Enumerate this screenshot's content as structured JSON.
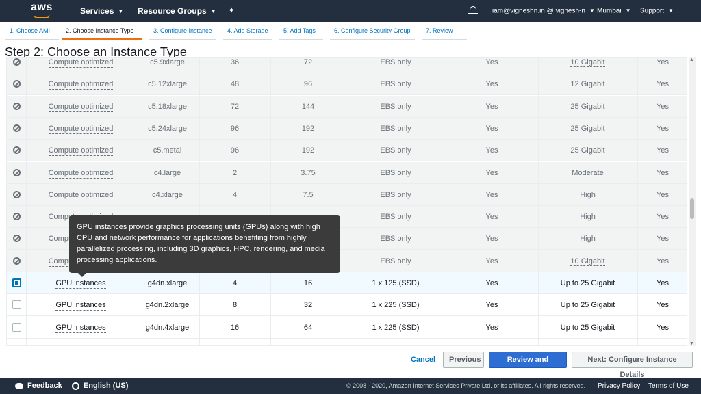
{
  "nav": {
    "logo": "aws",
    "services": "Services",
    "resource_groups": "Resource Groups",
    "user": "iam@vigneshn.in @ vignesh-n",
    "region": "Mumbai",
    "support": "Support"
  },
  "tabs": [
    {
      "label": "1. Choose AMI"
    },
    {
      "label": "2. Choose Instance Type"
    },
    {
      "label": "3. Configure Instance"
    },
    {
      "label": "4. Add Storage"
    },
    {
      "label": "5. Add Tags"
    },
    {
      "label": "6. Configure Security Group"
    },
    {
      "label": "7. Review"
    }
  ],
  "page_title": "Step 2: Choose an Instance Type",
  "rows": [
    {
      "state": "disabled",
      "family": "Compute optimized",
      "type": "c5.9xlarge",
      "vcpus": "36",
      "memory": "72",
      "storage": "EBS only",
      "ebs_opt": "Yes",
      "network": "10 Gigabit",
      "ipv6": "Yes"
    },
    {
      "state": "disabled",
      "family": "Compute optimized",
      "type": "c5.12xlarge",
      "vcpus": "48",
      "memory": "96",
      "storage": "EBS only",
      "ebs_opt": "Yes",
      "network": "12 Gigabit",
      "ipv6": "Yes"
    },
    {
      "state": "disabled",
      "family": "Compute optimized",
      "type": "c5.18xlarge",
      "vcpus": "72",
      "memory": "144",
      "storage": "EBS only",
      "ebs_opt": "Yes",
      "network": "25 Gigabit",
      "ipv6": "Yes"
    },
    {
      "state": "disabled",
      "family": "Compute optimized",
      "type": "c5.24xlarge",
      "vcpus": "96",
      "memory": "192",
      "storage": "EBS only",
      "ebs_opt": "Yes",
      "network": "25 Gigabit",
      "ipv6": "Yes"
    },
    {
      "state": "disabled",
      "family": "Compute optimized",
      "type": "c5.metal",
      "vcpus": "96",
      "memory": "192",
      "storage": "EBS only",
      "ebs_opt": "Yes",
      "network": "25 Gigabit",
      "ipv6": "Yes"
    },
    {
      "state": "disabled",
      "family": "Compute optimized",
      "type": "c4.large",
      "vcpus": "2",
      "memory": "3.75",
      "storage": "EBS only",
      "ebs_opt": "Yes",
      "network": "Moderate",
      "ipv6": "Yes"
    },
    {
      "state": "disabled",
      "family": "Compute optimized",
      "type": "c4.xlarge",
      "vcpus": "4",
      "memory": "7.5",
      "storage": "EBS only",
      "ebs_opt": "Yes",
      "network": "High",
      "ipv6": "Yes"
    },
    {
      "state": "disabled",
      "family": "Compute optimized",
      "type": "",
      "vcpus": "",
      "memory": "",
      "storage": "EBS only",
      "ebs_opt": "Yes",
      "network": "High",
      "ipv6": "Yes"
    },
    {
      "state": "disabled",
      "family": "Compute optimized",
      "type": "",
      "vcpus": "",
      "memory": "",
      "storage": "EBS only",
      "ebs_opt": "Yes",
      "network": "High",
      "ipv6": "Yes"
    },
    {
      "state": "disabled",
      "family": "Compute optimized",
      "type": "",
      "vcpus": "",
      "memory": "",
      "storage": "EBS only",
      "ebs_opt": "Yes",
      "network": "10 Gigabit",
      "ipv6": "Yes"
    },
    {
      "state": "selected",
      "family": "GPU instances",
      "type": "g4dn.xlarge",
      "vcpus": "4",
      "memory": "16",
      "storage": "1 x 125 (SSD)",
      "ebs_opt": "Yes",
      "network": "Up to 25 Gigabit",
      "ipv6": "Yes"
    },
    {
      "state": "available",
      "family": "GPU instances",
      "type": "g4dn.2xlarge",
      "vcpus": "8",
      "memory": "32",
      "storage": "1 x 225 (SSD)",
      "ebs_opt": "Yes",
      "network": "Up to 25 Gigabit",
      "ipv6": "Yes"
    },
    {
      "state": "available",
      "family": "GPU instances",
      "type": "g4dn.4xlarge",
      "vcpus": "16",
      "memory": "64",
      "storage": "1 x 225 (SSD)",
      "ebs_opt": "Yes",
      "network": "Up to 25 Gigabit",
      "ipv6": "Yes"
    }
  ],
  "tooltip": "GPU instances provide graphics processing units (GPUs) along with high CPU and network performance for applications benefiting from highly parallelized processing, including 3D graphics, HPC, rendering, and media processing applications.",
  "buttons": {
    "cancel": "Cancel",
    "previous": "Previous",
    "review_launch": "Review and Launch",
    "next": "Next: Configure Instance Details"
  },
  "footer": {
    "feedback": "Feedback",
    "language": "English (US)",
    "copyright": "© 2008 - 2020, Amazon Internet Services Private Ltd. or its affiliates. All rights reserved.",
    "privacy": "Privacy Policy",
    "terms": "Terms of Use"
  }
}
